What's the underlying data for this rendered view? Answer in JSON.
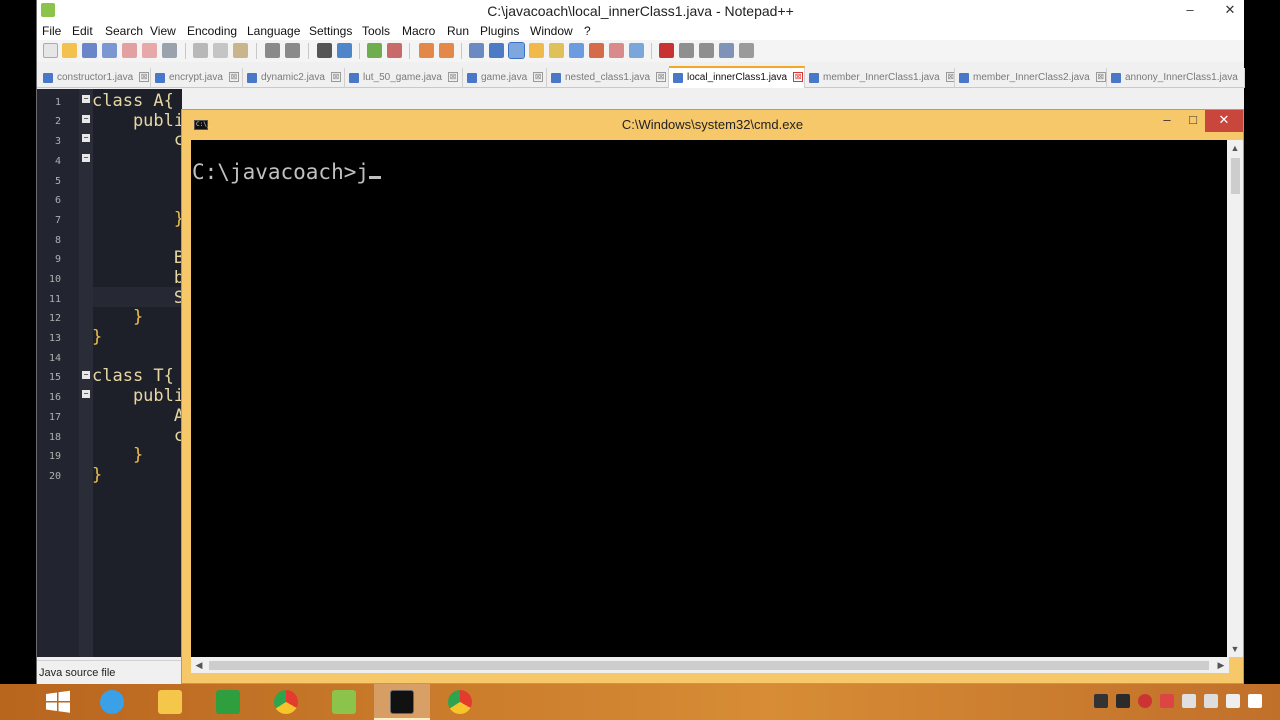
{
  "npp": {
    "title": "C:\\javacoach\\local_innerClass1.java - Notepad++",
    "title_controls": [
      "–",
      "✕"
    ],
    "menu": [
      "File",
      "Edit",
      "Search",
      "View",
      "Encoding",
      "Language",
      "Settings",
      "Tools",
      "Macro",
      "Run",
      "Plugins",
      "Window",
      "?"
    ],
    "tabs": [
      {
        "label": "constructor1.java",
        "active": false
      },
      {
        "label": "encrypt.java",
        "active": false
      },
      {
        "label": "dynamic2.java",
        "active": false
      },
      {
        "label": "lut_50_game.java",
        "active": false
      },
      {
        "label": "game.java",
        "active": false
      },
      {
        "label": "nested_class1.java",
        "active": false
      },
      {
        "label": "local_innerClass1.java",
        "active": true
      },
      {
        "label": "member_InnerClass1.java",
        "active": false
      },
      {
        "label": "member_InnerClass2.java",
        "active": false
      },
      {
        "label": "annony_InnerClass1.java",
        "active": false
      }
    ],
    "tab_close_glyph": "⊠",
    "line_numbers": [
      "1",
      "2",
      "3",
      "4",
      "5",
      "6",
      "7",
      "8",
      "9",
      "10",
      "11",
      "12",
      "13",
      "14",
      "15",
      "16",
      "17",
      "18",
      "19",
      "20"
    ],
    "code_lines": [
      "class A{",
      "    publi",
      "        c",
      "",
      "",
      "",
      "        }",
      "",
      "        B",
      "        b",
      "        S",
      "    }",
      "}",
      "",
      "class T{",
      "    publi",
      "        A",
      "        c",
      "    }",
      "}"
    ],
    "status": "Java source file"
  },
  "cmd": {
    "title": "C:\\Windows\\system32\\cmd.exe",
    "icon_text": "C:\\_",
    "prompt": "C:\\javacoach>j",
    "controls": {
      "minimize": "–",
      "maximize": "□",
      "close": "✕"
    }
  },
  "taskbar": {
    "items": [
      {
        "name": "start-button",
        "icon": "windows-logo-icon",
        "color": "#ffffff"
      },
      {
        "name": "internet-explorer",
        "icon": "internet-explorer-icon",
        "color": "#3aa0e8"
      },
      {
        "name": "file-explorer",
        "icon": "folder-icon",
        "color": "#f4c64a"
      },
      {
        "name": "store",
        "icon": "store-icon",
        "color": "#2e9e3e"
      },
      {
        "name": "chrome",
        "icon": "chrome-icon",
        "color": "#e33b2e"
      },
      {
        "name": "notepad-plus-plus",
        "icon": "notepad-icon",
        "color": "#8cc34a"
      },
      {
        "name": "cmd",
        "icon": "cmd-icon",
        "color": "#111111"
      },
      {
        "name": "chrome-2",
        "icon": "chrome-icon",
        "color": "#e33b2e"
      }
    ],
    "tray_icons": [
      "network-icon",
      "app-icon",
      "security-icon",
      "record-icon",
      "flag-icon",
      "battery-icon",
      "signal-icon",
      "volume-icon"
    ]
  }
}
